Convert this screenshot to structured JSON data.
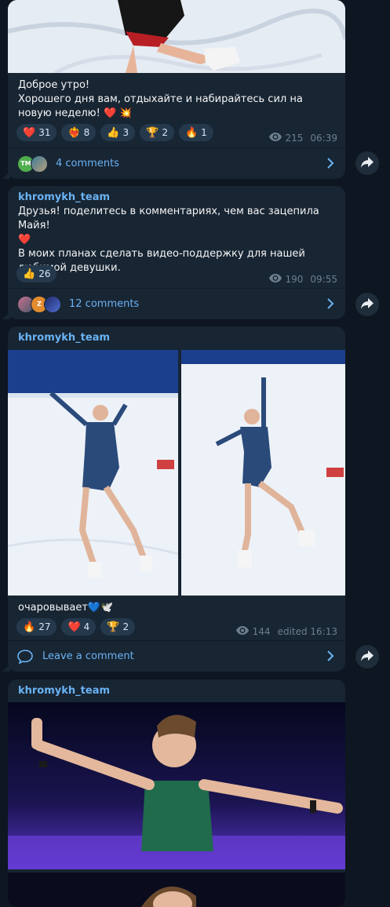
{
  "posts": [
    {
      "text_lines": [
        "Доброе утро!",
        "Хорошего дня вам, отдыхайте и набирайтесь сил на новую неделю! ❤️ 💥"
      ],
      "reactions": [
        {
          "emoji": "❤️",
          "count": "31"
        },
        {
          "emoji": "❤️‍🔥",
          "count": "8"
        },
        {
          "emoji": "👍",
          "count": "3"
        },
        {
          "emoji": "🏆",
          "count": "2"
        },
        {
          "emoji": "🔥",
          "count": "1"
        }
      ],
      "views": "215",
      "time": "06:39",
      "comments_label": "4 comments",
      "avatar_initials": [
        "TM",
        ""
      ]
    },
    {
      "author": "khromykh_team",
      "text_lines": [
        "Друзья! поделитесь в комментариях, чем вас зацепила Майя!",
        "❤️",
        "В моих планах сделать видео-поддержку для нашей любимой девушки."
      ],
      "reactions": [
        {
          "emoji": "👍",
          "count": "26"
        }
      ],
      "views": "190",
      "time": "09:55",
      "comments_label": "12 comments",
      "avatar_initials": [
        "",
        "Z",
        ""
      ]
    },
    {
      "author": "khromykh_team",
      "text": "очаровывает💙🕊️",
      "reactions": [
        {
          "emoji": "🔥",
          "count": "27"
        },
        {
          "emoji": "❤️",
          "count": "4"
        },
        {
          "emoji": "🏆",
          "count": "2"
        }
      ],
      "views": "144",
      "time": "edited 16:13",
      "comments_label": "Leave a comment"
    },
    {
      "author": "khromykh_team"
    }
  ],
  "colors": {
    "background": "#0e1621",
    "bubble": "#182533",
    "accent": "#6ab3f3",
    "meta": "#6d7f8f"
  }
}
